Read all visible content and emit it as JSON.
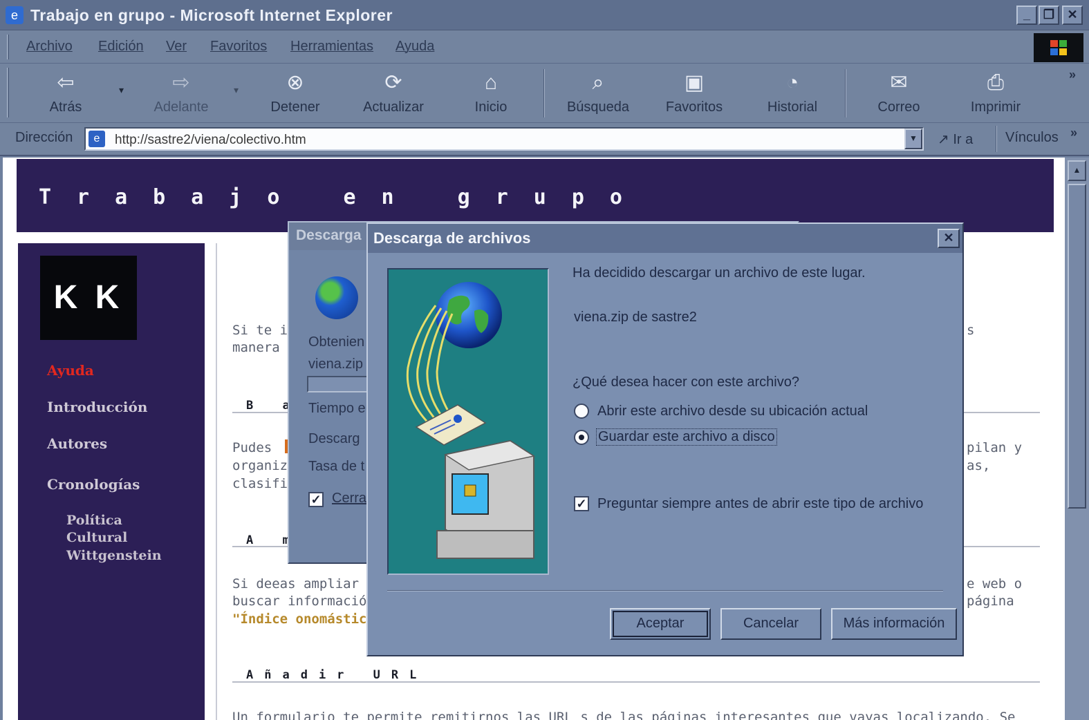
{
  "window": {
    "title": "Trabajo en grupo - Microsoft Internet Explorer",
    "controls": [
      "_",
      "❐",
      "✕"
    ]
  },
  "menu": [
    "Archivo",
    "Edición",
    "Ver",
    "Favoritos",
    "Herramientas",
    "Ayuda"
  ],
  "toolbar": [
    {
      "label": "Atrás",
      "icon": "back-arrow-icon",
      "glyph": "⇦"
    },
    {
      "label": "Adelante",
      "icon": "forward-arrow-icon",
      "glyph": "⇨"
    },
    {
      "label": "Detener",
      "icon": "stop-icon",
      "glyph": "⊗"
    },
    {
      "label": "Actualizar",
      "icon": "refresh-icon",
      "glyph": "⟳"
    },
    {
      "label": "Inicio",
      "icon": "home-icon",
      "glyph": "⌂"
    },
    {
      "label": "Búsqueda",
      "icon": "search-icon",
      "glyph": "⌕"
    },
    {
      "label": "Favoritos",
      "icon": "favorites-icon",
      "glyph": "▣"
    },
    {
      "label": "Historial",
      "icon": "history-icon",
      "glyph": "◔"
    },
    {
      "label": "Correo",
      "icon": "mail-icon",
      "glyph": "✉"
    },
    {
      "label": "Imprimir",
      "icon": "print-icon",
      "glyph": "⎙"
    }
  ],
  "toolbar_more": "»",
  "address": {
    "label": "Dirección",
    "url": "http://sastre2/viena/colectivo.htm",
    "go_label": "Ir a",
    "links_label": "Vínculos",
    "links_more": "»"
  },
  "page": {
    "banner_title": "Trabajo en grupo",
    "logo_text": "K K",
    "nav": [
      {
        "label": "Ayuda",
        "active": true
      },
      {
        "label": "Introducción",
        "active": false
      },
      {
        "label": "Autores",
        "active": false
      },
      {
        "label": "Cronologías",
        "active": false
      }
    ],
    "subnav": [
      "Política",
      "Cultural",
      "Wittgenstein"
    ],
    "para1_line1_start": "Si te in",
    "para1_line1_end": "s",
    "para1_line2_start": "manera",
    "section1": "B a",
    "para2_line1_start": "Pudes",
    "para2_line1_end": "pilan y",
    "para2_line2_start": "organiz",
    "para2_line2_end": "as,",
    "para2_line3_start": "clasific",
    "section2": "A m",
    "para3_line1_start": "Si deeas ampliar",
    "para3_line1_end": "e web o",
    "para3_line2_start": "buscar informació",
    "para3_line2_end": "página",
    "para3_line3": "\"Índice onomástic",
    "section3": "Añadir URL",
    "para4_partial": "Un formulario te permite remitirnos las URL s de las páginas interesantes que vayas localizando. Se"
  },
  "back_dialog": {
    "title": "Descarga",
    "line_obtaining": "Obtenien",
    "line_file": "viena.zip",
    "line_time": "Tiempo e",
    "line_download": "Descarg",
    "line_rate": "Tasa de t",
    "checkbox_label": "Cerra"
  },
  "dialog": {
    "title": "Descarga de archivos",
    "close": "✕",
    "intro": "Ha decidido descargar un archivo de este lugar.",
    "file": "viena.zip de sastre2",
    "question": "¿Qué desea hacer con este archivo?",
    "option_open": "Abrir este archivo desde su ubicación actual",
    "option_save": "Guardar este archivo a disco",
    "selected_option": "option_save",
    "always_ask": "Preguntar siempre antes de abrir este tipo de archivo",
    "always_ask_checked": true,
    "btn_ok": "Aceptar",
    "btn_cancel": "Cancelar",
    "btn_more": "Más información"
  },
  "colors": {
    "chrome": "#73849f",
    "title_bar": "#5e6f8e",
    "dialog": "#7b8fb0",
    "banner": "#2c1f56",
    "active_nav": "#e2281f",
    "illustration_bg": "#1e7f82"
  }
}
